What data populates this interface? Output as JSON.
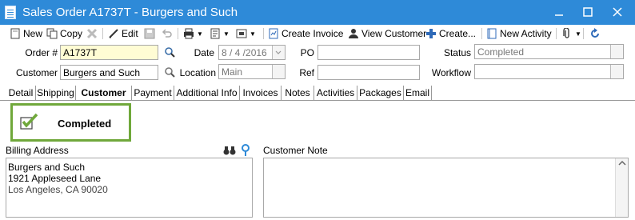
{
  "window": {
    "title": "Sales Order A1737T - Burgers and Such",
    "colors": {
      "titlebar": "#2e8ad8",
      "status_border": "#70a83b",
      "order_field": "#fffcd4"
    }
  },
  "toolbar": {
    "new": "New",
    "copy": "Copy",
    "edit": "Edit",
    "create_invoice": "Create Invoice",
    "view_customer": "View Customer",
    "create": "Create...",
    "new_activity": "New Activity"
  },
  "form": {
    "order_label": "Order #",
    "order_value": "A1737T",
    "customer_label": "Customer",
    "customer_value": "Burgers and Such",
    "date_label": "Date",
    "date_value": "8 / 4 /2016",
    "location_label": "Location",
    "location_value": "Main",
    "po_label": "PO",
    "po_value": "",
    "ref_label": "Ref",
    "ref_value": "",
    "status_label": "Status",
    "status_value": "Completed",
    "workflow_label": "Workflow",
    "workflow_value": ""
  },
  "tabs": [
    "Detail",
    "Shipping",
    "Customer",
    "Payment",
    "Additional Info",
    "Invoices",
    "Notes",
    "Activities",
    "Packages",
    "Email"
  ],
  "active_tab": "Customer",
  "status_card": {
    "text": "Completed"
  },
  "billing": {
    "label": "Billing Address",
    "lines": [
      "Burgers and Such",
      "1921 Appleseed Lane",
      "Los Angeles, CA 90020"
    ]
  },
  "customer_note": {
    "label": "Customer Note",
    "value": ""
  }
}
